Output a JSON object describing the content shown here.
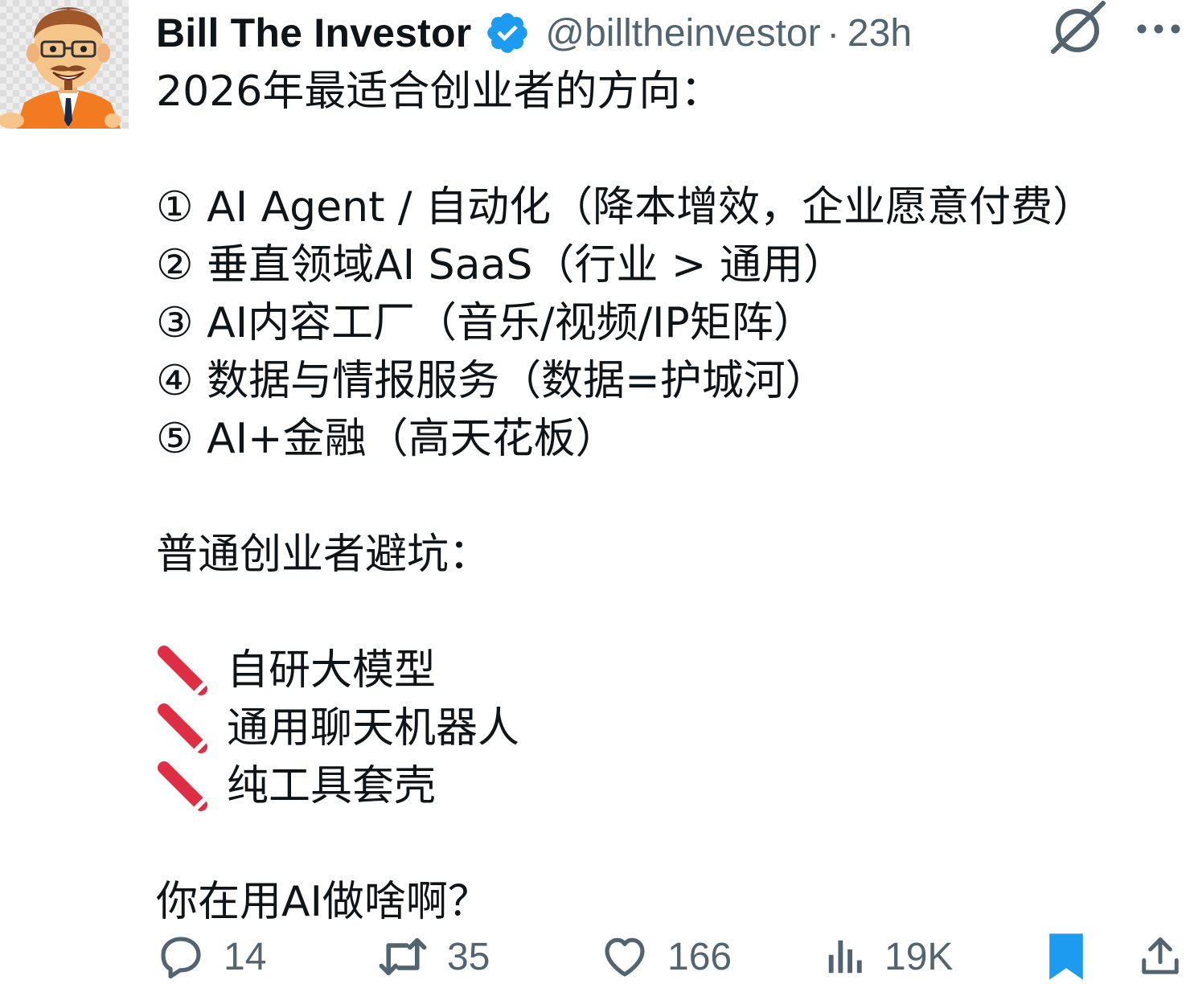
{
  "tweet": {
    "author": {
      "display_name": "Bill The Investor",
      "handle": "@billtheinvestor",
      "verified": true,
      "avatar_icon": "cartoon-man-avatar"
    },
    "separator": "·",
    "timestamp": "23h",
    "lines": [
      "2026年最适合创业者的方向：",
      "",
      "① AI Agent / 自动化（降本增效，企业愿意付费）",
      "② 垂直领域AI SaaS（行业 > 通用）",
      "③ AI内容工厂（音乐/视频/IP矩阵）",
      "④ 数据与情报服务（数据=护城河）",
      "⑤ AI+金融（高天花板）",
      "",
      "普通创业者避坑：",
      "",
      "自研大模型",
      "通用聊天机器人",
      "纯工具套壳",
      "",
      "你在用AI做啥啊？"
    ],
    "pencil_items_icon": "pencil-icon"
  },
  "actions": {
    "replies": "14",
    "reposts": "35",
    "likes": "166",
    "views": "19K"
  },
  "colors": {
    "text": "#0f1419",
    "muted": "#536471",
    "verified_blue": "#1d9bf0",
    "bookmark_blue": "#1d9bf0",
    "pencil_red": "#dd2e44"
  }
}
